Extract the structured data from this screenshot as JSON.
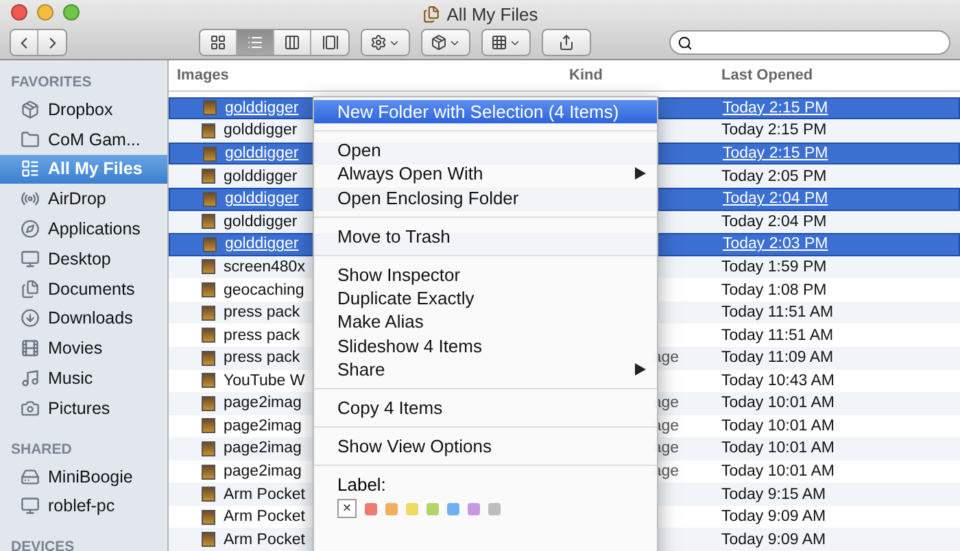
{
  "window": {
    "title": "All My Files"
  },
  "toolbar": {
    "view_modes": [
      {
        "selected": false
      },
      {
        "selected": true
      },
      {
        "selected": false
      },
      {
        "selected": false
      }
    ]
  },
  "sidebar": [
    {
      "title": "FAVORITES",
      "items": [
        {
          "label": "Dropbox",
          "selected": false
        },
        {
          "label": "CoM Gam...",
          "selected": false
        },
        {
          "label": "All My Files",
          "selected": true
        },
        {
          "label": "AirDrop",
          "selected": false
        },
        {
          "label": "Applications",
          "selected": false
        },
        {
          "label": "Desktop",
          "selected": false
        },
        {
          "label": "Documents",
          "selected": false
        },
        {
          "label": "Downloads",
          "selected": false
        },
        {
          "label": "Movies",
          "selected": false
        },
        {
          "label": "Music",
          "selected": false
        },
        {
          "label": "Pictures",
          "selected": false
        }
      ]
    },
    {
      "title": "SHARED",
      "items": [
        {
          "label": "MiniBoogie",
          "selected": false
        },
        {
          "label": "roblef-pc",
          "selected": false
        }
      ]
    },
    {
      "title": "DEVICES"
    }
  ],
  "table": {
    "columns": [
      "Images",
      "Kind",
      "Last Opened"
    ],
    "rows": [
      {
        "name": "golddigger",
        "kind": "",
        "opened": "Today 2:15 PM",
        "selected": true
      },
      {
        "name": "golddigger",
        "kind": "",
        "opened": "Today 2:15 PM",
        "selected": false
      },
      {
        "name": "golddigger",
        "kind": "",
        "opened": "Today 2:15 PM",
        "selected": true
      },
      {
        "name": "golddigger",
        "kind": "",
        "opened": "Today 2:05 PM",
        "selected": false
      },
      {
        "name": "golddigger",
        "kind": "",
        "opened": "Today 2:04 PM",
        "selected": true
      },
      {
        "name": "golddigger",
        "kind": "",
        "opened": "Today 2:04 PM",
        "selected": false
      },
      {
        "name": "golddigger",
        "kind": "",
        "opened": "Today 2:03 PM",
        "selected": true
      },
      {
        "name": "screen480x",
        "kind": "",
        "opened": "Today 1:59 PM",
        "selected": false
      },
      {
        "name": "geocaching",
        "kind": "",
        "opened": "Today 1:08 PM",
        "selected": false
      },
      {
        "name": "press pack",
        "kind": "",
        "opened": "Today 11:51 AM",
        "selected": false
      },
      {
        "name": "press pack",
        "kind": "",
        "opened": "Today 11:51 AM",
        "selected": false
      },
      {
        "name": "press pack",
        "kind": "age",
        "opened": "Today 11:09 AM",
        "selected": false
      },
      {
        "name": "YouTube W",
        "kind": "",
        "opened": "Today 10:43 AM",
        "selected": false
      },
      {
        "name": "page2imag",
        "kind": "age",
        "opened": "Today 10:01 AM",
        "selected": false
      },
      {
        "name": "page2imag",
        "kind": "age",
        "opened": "Today 10:01 AM",
        "selected": false
      },
      {
        "name": "page2imag",
        "kind": "age",
        "opened": "Today 10:01 AM",
        "selected": false
      },
      {
        "name": "page2imag",
        "kind": "age",
        "opened": "Today 10:01 AM",
        "selected": false
      },
      {
        "name": "Arm Pocket",
        "kind": "",
        "opened": "Today 9:15 AM",
        "selected": false
      },
      {
        "name": "Arm Pocket",
        "kind": "",
        "opened": "Today 9:09 AM",
        "selected": false
      },
      {
        "name": "Arm Pocket",
        "kind": "",
        "opened": "Today 9:09 AM",
        "selected": false
      }
    ]
  },
  "context_menu": {
    "items": [
      {
        "kind": "item",
        "label": "New Folder with Selection (4 Items)",
        "selected": true,
        "submenu": false
      },
      {
        "kind": "separator"
      },
      {
        "kind": "item",
        "label": "Open",
        "selected": false,
        "submenu": false
      },
      {
        "kind": "item",
        "label": "Always Open With",
        "selected": false,
        "submenu": true
      },
      {
        "kind": "item",
        "label": "Open Enclosing Folder",
        "selected": false,
        "submenu": false
      },
      {
        "kind": "separator"
      },
      {
        "kind": "item",
        "label": "Move to Trash",
        "selected": false,
        "submenu": false
      },
      {
        "kind": "separator"
      },
      {
        "kind": "item",
        "label": "Show Inspector",
        "selected": false,
        "submenu": false
      },
      {
        "kind": "item",
        "label": "Duplicate Exactly",
        "selected": false,
        "submenu": false
      },
      {
        "kind": "item",
        "label": "Make Alias",
        "selected": false,
        "submenu": false
      },
      {
        "kind": "item",
        "label": "Slideshow 4 Items",
        "selected": false,
        "submenu": false
      },
      {
        "kind": "item",
        "label": "Share",
        "selected": false,
        "submenu": true
      },
      {
        "kind": "separator"
      },
      {
        "kind": "item",
        "label": "Copy 4 Items",
        "selected": false,
        "submenu": false
      },
      {
        "kind": "separator"
      },
      {
        "kind": "item",
        "label": "Show View Options",
        "selected": false,
        "submenu": false
      },
      {
        "kind": "separator"
      },
      {
        "kind": "labels",
        "label": "Label:",
        "clear": "×",
        "colors": [
          {
            "color": "#ec7b72"
          },
          {
            "color": "#f2b05e"
          },
          {
            "color": "#eedc62"
          },
          {
            "color": "#b3d66a"
          },
          {
            "color": "#6fb1ee"
          },
          {
            "color": "#c79ae0"
          },
          {
            "color": "#bdbdbd"
          }
        ]
      }
    ]
  }
}
